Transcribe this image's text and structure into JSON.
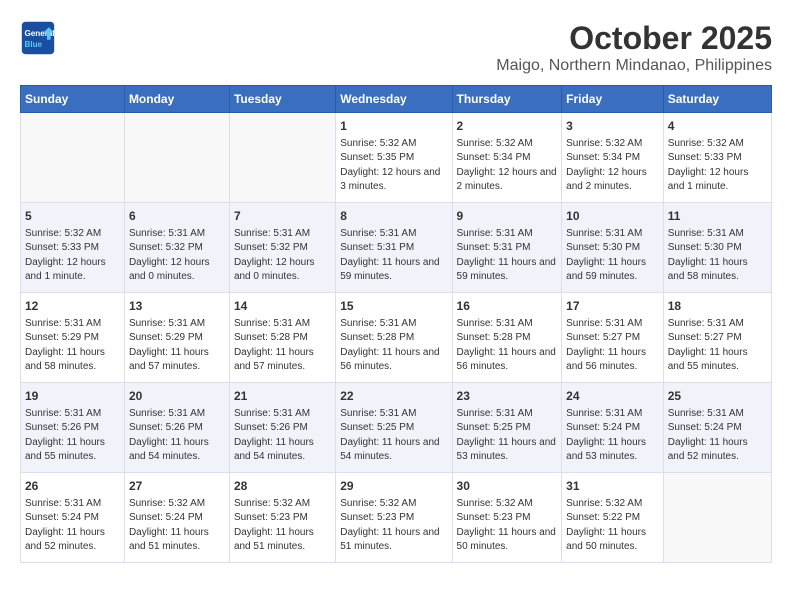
{
  "header": {
    "logo_line1": "General",
    "logo_line2": "Blue",
    "title": "October 2025",
    "subtitle": "Maigo, Northern Mindanao, Philippines"
  },
  "days_of_week": [
    "Sunday",
    "Monday",
    "Tuesday",
    "Wednesday",
    "Thursday",
    "Friday",
    "Saturday"
  ],
  "weeks": [
    [
      {
        "day": "",
        "info": ""
      },
      {
        "day": "",
        "info": ""
      },
      {
        "day": "",
        "info": ""
      },
      {
        "day": "1",
        "info": "Sunrise: 5:32 AM\nSunset: 5:35 PM\nDaylight: 12 hours and 3 minutes."
      },
      {
        "day": "2",
        "info": "Sunrise: 5:32 AM\nSunset: 5:34 PM\nDaylight: 12 hours and 2 minutes."
      },
      {
        "day": "3",
        "info": "Sunrise: 5:32 AM\nSunset: 5:34 PM\nDaylight: 12 hours and 2 minutes."
      },
      {
        "day": "4",
        "info": "Sunrise: 5:32 AM\nSunset: 5:33 PM\nDaylight: 12 hours and 1 minute."
      }
    ],
    [
      {
        "day": "5",
        "info": "Sunrise: 5:32 AM\nSunset: 5:33 PM\nDaylight: 12 hours and 1 minute."
      },
      {
        "day": "6",
        "info": "Sunrise: 5:31 AM\nSunset: 5:32 PM\nDaylight: 12 hours and 0 minutes."
      },
      {
        "day": "7",
        "info": "Sunrise: 5:31 AM\nSunset: 5:32 PM\nDaylight: 12 hours and 0 minutes."
      },
      {
        "day": "8",
        "info": "Sunrise: 5:31 AM\nSunset: 5:31 PM\nDaylight: 11 hours and 59 minutes."
      },
      {
        "day": "9",
        "info": "Sunrise: 5:31 AM\nSunset: 5:31 PM\nDaylight: 11 hours and 59 minutes."
      },
      {
        "day": "10",
        "info": "Sunrise: 5:31 AM\nSunset: 5:30 PM\nDaylight: 11 hours and 59 minutes."
      },
      {
        "day": "11",
        "info": "Sunrise: 5:31 AM\nSunset: 5:30 PM\nDaylight: 11 hours and 58 minutes."
      }
    ],
    [
      {
        "day": "12",
        "info": "Sunrise: 5:31 AM\nSunset: 5:29 PM\nDaylight: 11 hours and 58 minutes."
      },
      {
        "day": "13",
        "info": "Sunrise: 5:31 AM\nSunset: 5:29 PM\nDaylight: 11 hours and 57 minutes."
      },
      {
        "day": "14",
        "info": "Sunrise: 5:31 AM\nSunset: 5:28 PM\nDaylight: 11 hours and 57 minutes."
      },
      {
        "day": "15",
        "info": "Sunrise: 5:31 AM\nSunset: 5:28 PM\nDaylight: 11 hours and 56 minutes."
      },
      {
        "day": "16",
        "info": "Sunrise: 5:31 AM\nSunset: 5:28 PM\nDaylight: 11 hours and 56 minutes."
      },
      {
        "day": "17",
        "info": "Sunrise: 5:31 AM\nSunset: 5:27 PM\nDaylight: 11 hours and 56 minutes."
      },
      {
        "day": "18",
        "info": "Sunrise: 5:31 AM\nSunset: 5:27 PM\nDaylight: 11 hours and 55 minutes."
      }
    ],
    [
      {
        "day": "19",
        "info": "Sunrise: 5:31 AM\nSunset: 5:26 PM\nDaylight: 11 hours and 55 minutes."
      },
      {
        "day": "20",
        "info": "Sunrise: 5:31 AM\nSunset: 5:26 PM\nDaylight: 11 hours and 54 minutes."
      },
      {
        "day": "21",
        "info": "Sunrise: 5:31 AM\nSunset: 5:26 PM\nDaylight: 11 hours and 54 minutes."
      },
      {
        "day": "22",
        "info": "Sunrise: 5:31 AM\nSunset: 5:25 PM\nDaylight: 11 hours and 54 minutes."
      },
      {
        "day": "23",
        "info": "Sunrise: 5:31 AM\nSunset: 5:25 PM\nDaylight: 11 hours and 53 minutes."
      },
      {
        "day": "24",
        "info": "Sunrise: 5:31 AM\nSunset: 5:24 PM\nDaylight: 11 hours and 53 minutes."
      },
      {
        "day": "25",
        "info": "Sunrise: 5:31 AM\nSunset: 5:24 PM\nDaylight: 11 hours and 52 minutes."
      }
    ],
    [
      {
        "day": "26",
        "info": "Sunrise: 5:31 AM\nSunset: 5:24 PM\nDaylight: 11 hours and 52 minutes."
      },
      {
        "day": "27",
        "info": "Sunrise: 5:32 AM\nSunset: 5:24 PM\nDaylight: 11 hours and 51 minutes."
      },
      {
        "day": "28",
        "info": "Sunrise: 5:32 AM\nSunset: 5:23 PM\nDaylight: 11 hours and 51 minutes."
      },
      {
        "day": "29",
        "info": "Sunrise: 5:32 AM\nSunset: 5:23 PM\nDaylight: 11 hours and 51 minutes."
      },
      {
        "day": "30",
        "info": "Sunrise: 5:32 AM\nSunset: 5:23 PM\nDaylight: 11 hours and 50 minutes."
      },
      {
        "day": "31",
        "info": "Sunrise: 5:32 AM\nSunset: 5:22 PM\nDaylight: 11 hours and 50 minutes."
      },
      {
        "day": "",
        "info": ""
      }
    ]
  ]
}
